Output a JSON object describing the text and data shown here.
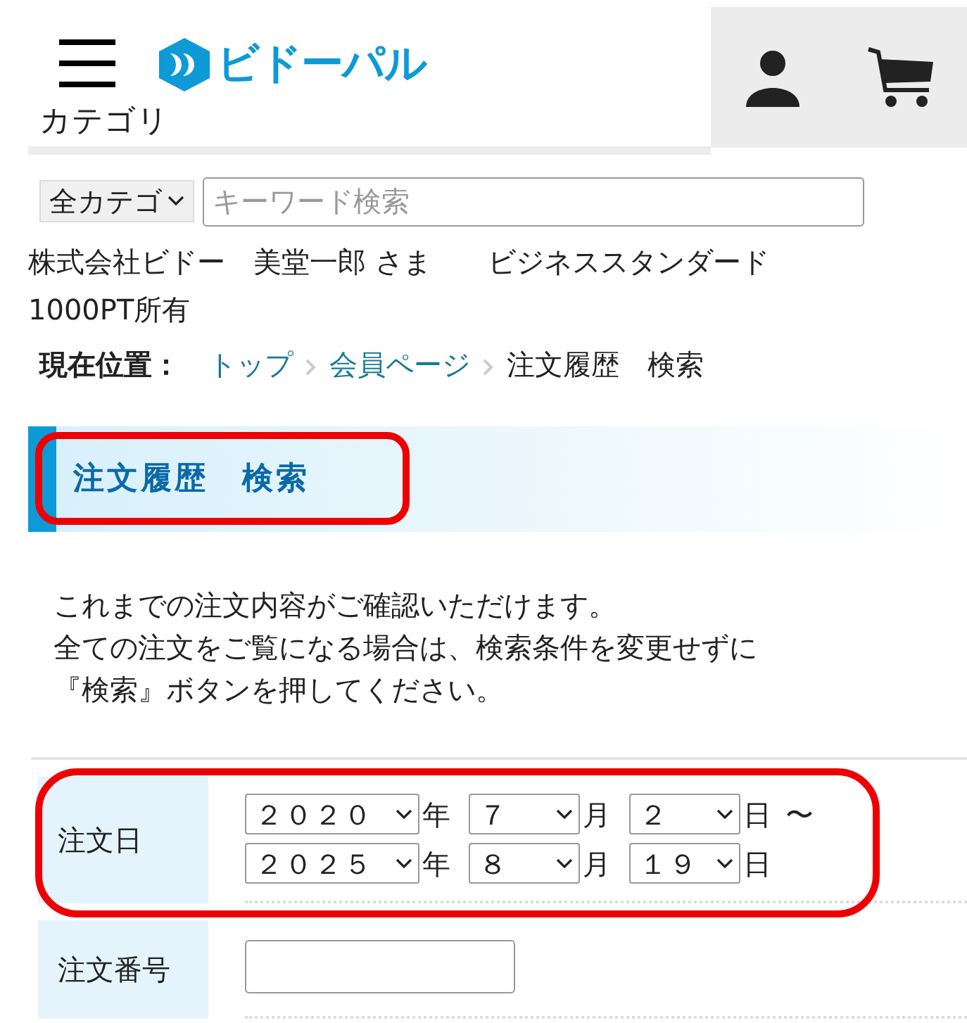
{
  "header": {
    "logo": "ビドーパル",
    "menu_label": "カテゴリ"
  },
  "search": {
    "category": "全カテゴ",
    "placeholder": "キーワード検索"
  },
  "user_info": "株式会社ビドー　美堂一郎 さま　　ビジネススタンダード　1000PT所有",
  "breadcrumb": {
    "label": "現在位置：",
    "items": [
      {
        "text": "トップ",
        "link": true
      },
      {
        "text": "会員ページ",
        "link": true
      },
      {
        "text": "注文履歴　検索",
        "link": false
      }
    ]
  },
  "heading": {
    "text": "注文履歴　検索",
    "highlighted": true
  },
  "intro": [
    "これまでの注文内容がご確認いただけます。",
    "全ての注文をご覧になる場合は、検索条件を変更せずに",
    "『検索』ボタンを押してください。"
  ],
  "form_rows": [
    {
      "kind": "date_range",
      "label": "注文日",
      "highlighted": true,
      "lines": [
        {
          "selects": [
            {
              "value": "２０２０",
              "unit": "年"
            },
            {
              "value": "７",
              "unit": "月"
            },
            {
              "value": "２",
              "unit": "日"
            }
          ],
          "suffix": "〜"
        },
        {
          "selects": [
            {
              "value": "２０２５",
              "unit": "年"
            },
            {
              "value": "８",
              "unit": "月"
            },
            {
              "value": "１９",
              "unit": "日"
            }
          ]
        }
      ]
    },
    {
      "kind": "text",
      "label": "注文番号",
      "highlighted": false
    }
  ]
}
